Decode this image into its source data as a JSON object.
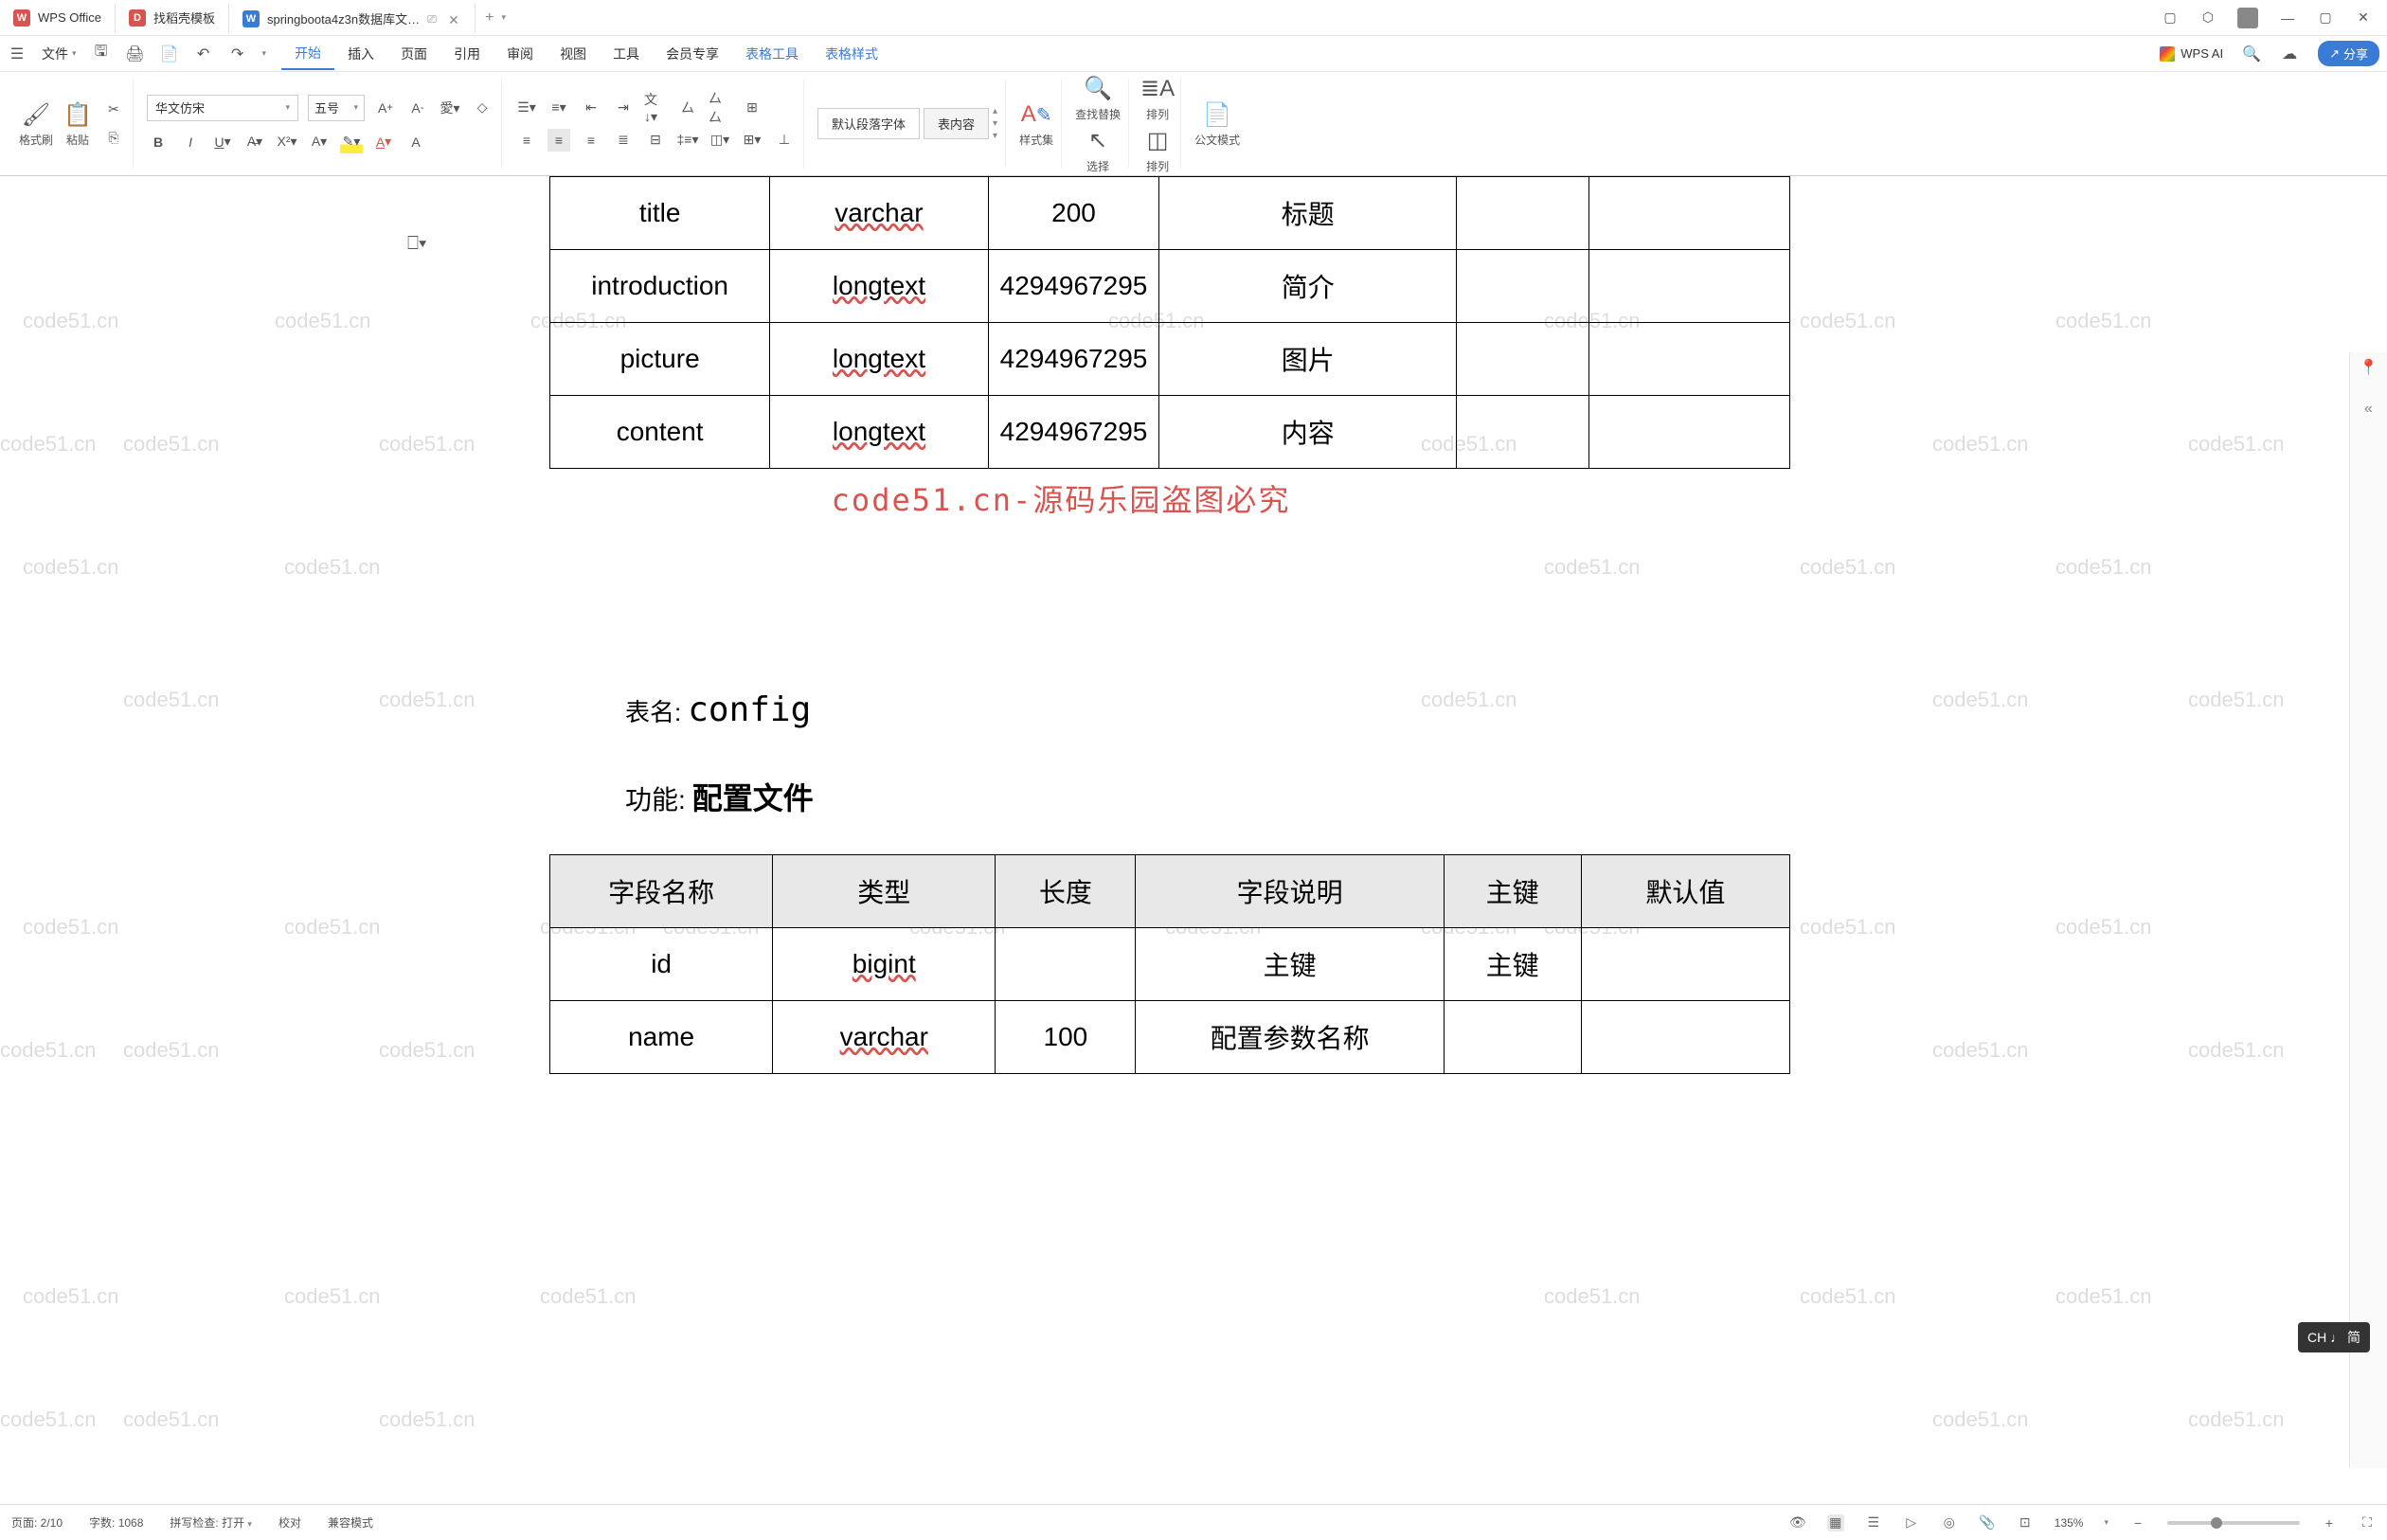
{
  "tabs": {
    "wps": "WPS Office",
    "daoke": "找稻壳模板",
    "doc": "springboota4z3n数据库文…"
  },
  "menu": {
    "file": "文件",
    "start": "开始",
    "insert": "插入",
    "page": "页面",
    "reference": "引用",
    "review": "审阅",
    "view": "视图",
    "tools": "工具",
    "member": "会员专享",
    "table_tools": "表格工具",
    "table_style": "表格样式",
    "wps_ai": "WPS AI",
    "share": "分享"
  },
  "ribbon": {
    "format_painter": "格式刷",
    "paste": "粘贴",
    "font_name": "华文仿宋",
    "font_size": "五号",
    "default_para": "默认段落字体",
    "table_content": "表内容",
    "styles": "样式集",
    "find_replace": "查找替换",
    "select": "选择",
    "arrange1": "排列",
    "arrange2": "排列",
    "formal": "公文模式"
  },
  "table1_rows": [
    {
      "c1": "title",
      "c2": "varchar",
      "c3": "200",
      "c4": "标题",
      "c5": "",
      "c6": ""
    },
    {
      "c1": "introduction",
      "c2": "longtext",
      "c3": "4294967295",
      "c4": "简介",
      "c5": "",
      "c6": ""
    },
    {
      "c1": "picture",
      "c2": "longtext",
      "c3": "4294967295",
      "c4": "图片",
      "c5": "",
      "c6": ""
    },
    {
      "c1": "content",
      "c2": "longtext",
      "c3": "4294967295",
      "c4": "内容",
      "c5": "",
      "c6": ""
    }
  ],
  "banner": "code51.cn-源码乐园盗图必究",
  "caption1": {
    "label": "表名:",
    "value": "config"
  },
  "caption2": {
    "label": "功能:",
    "value": "配置文件"
  },
  "table2_headers": [
    "字段名称",
    "类型",
    "长度",
    "字段说明",
    "主键",
    "默认值"
  ],
  "table2_rows": [
    {
      "c1": "id",
      "c2": "bigint",
      "c3": "",
      "c4": "主键",
      "c5": "主键",
      "c6": ""
    },
    {
      "c1": "name",
      "c2": "varchar",
      "c3": "100",
      "c4": "配置参数名称",
      "c5": "",
      "c6": ""
    }
  ],
  "watermark": "code51.cn",
  "status": {
    "page": "页面: 2/10",
    "words": "字数: 1068",
    "spell": "拼写检查: 打开",
    "proof": "校对",
    "compat": "兼容模式",
    "zoom": "135%"
  },
  "ime": "CH ♩ 简"
}
